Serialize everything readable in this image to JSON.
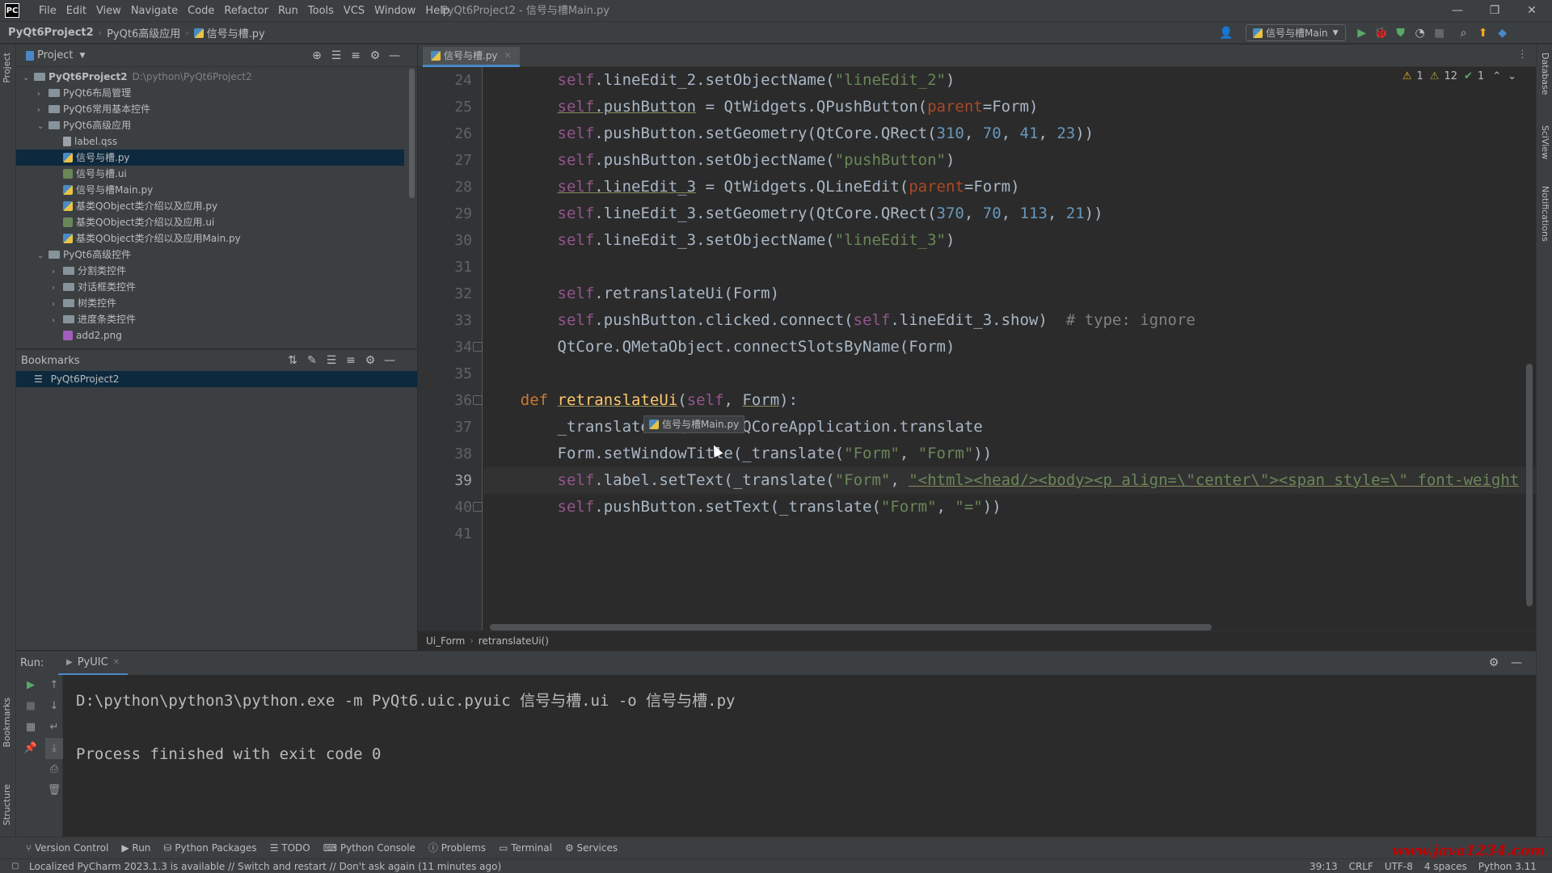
{
  "titlebar": {
    "logo": "PC",
    "menu": [
      "File",
      "Edit",
      "View",
      "Navigate",
      "Code",
      "Refactor",
      "Run",
      "Tools",
      "VCS",
      "Window",
      "Help"
    ],
    "window_title": "PyQt6Project2 - 信号与槽Main.py",
    "minimize": "—",
    "restore": "❐",
    "close": "✕"
  },
  "navbar": {
    "crumbs": [
      "PyQt6Project2",
      "PyQt6高级应用",
      "信号与槽.py"
    ],
    "run_config": "信号与槽Main"
  },
  "stripes": {
    "left_top": "Project",
    "left_bookmarks": "Bookmarks",
    "left_structure": "Structure",
    "right_database": "Database",
    "right_sciview": "SciView",
    "right_notifications": "Notifications"
  },
  "project_panel": {
    "title": "Project",
    "tree": [
      {
        "label": "PyQt6Project2",
        "hint": "D:\\python\\PyQt6Project2",
        "type": "folder",
        "indent": 0,
        "expanded": true,
        "bold": true
      },
      {
        "label": "PyQt6布局管理",
        "type": "folder",
        "indent": 1,
        "expanded": false
      },
      {
        "label": "PyQt6常用基本控件",
        "type": "folder",
        "indent": 1,
        "expanded": false
      },
      {
        "label": "PyQt6高级应用",
        "type": "folder",
        "indent": 1,
        "expanded": true
      },
      {
        "label": "label.qss",
        "type": "qss",
        "indent": 2
      },
      {
        "label": "信号与槽.py",
        "type": "py",
        "indent": 2,
        "selected": true
      },
      {
        "label": "信号与槽.ui",
        "type": "ui",
        "indent": 2
      },
      {
        "label": "信号与槽Main.py",
        "type": "py",
        "indent": 2
      },
      {
        "label": "基类QObject类介绍以及应用.py",
        "type": "py",
        "indent": 2
      },
      {
        "label": "基类QObject类介绍以及应用.ui",
        "type": "ui",
        "indent": 2
      },
      {
        "label": "基类QObject类介绍以及应用Main.py",
        "type": "py",
        "indent": 2
      },
      {
        "label": "PyQt6高级控件",
        "type": "folder",
        "indent": 1,
        "expanded": true
      },
      {
        "label": "分割类控件",
        "type": "folder",
        "indent": 2,
        "expanded": false
      },
      {
        "label": "对话框类控件",
        "type": "folder",
        "indent": 2,
        "expanded": false
      },
      {
        "label": "树类控件",
        "type": "folder",
        "indent": 2,
        "expanded": false
      },
      {
        "label": "进度条类控件",
        "type": "folder",
        "indent": 2,
        "expanded": false
      },
      {
        "label": "add2.png",
        "type": "png",
        "indent": 2
      }
    ]
  },
  "bookmarks_panel": {
    "title": "Bookmarks",
    "items": [
      "PyQt6Project2"
    ]
  },
  "editor": {
    "tab_label": "信号与槽.py",
    "inspection": {
      "warnings": "1",
      "weak_warnings": "12",
      "typos": "1"
    },
    "line_numbers": [
      "24",
      "25",
      "26",
      "27",
      "28",
      "29",
      "30",
      "31",
      "32",
      "33",
      "34",
      "35",
      "36",
      "37",
      "38",
      "39",
      "40",
      "41"
    ],
    "current_line": "39",
    "tooltip": "信号与槽Main.py",
    "breadcrumb": [
      "Ui_Form",
      "retranslateUi()"
    ]
  },
  "run_panel": {
    "label": "Run:",
    "tab": "PyUIC",
    "console": [
      "D:\\python\\python3\\python.exe -m PyQt6.uic.pyuic 信号与槽.ui -o 信号与槽.py",
      "",
      "Process finished with exit code 0"
    ]
  },
  "bottom_tools": [
    "Version Control",
    "Run",
    "Python Packages",
    "TODO",
    "Python Console",
    "Problems",
    "Terminal",
    "Services"
  ],
  "statusbar": {
    "message": "Localized PyCharm 2023.1.3 is available // Switch and restart // Don't ask again (11 minutes ago)",
    "position": "39:13",
    "line_sep": "CRLF",
    "encoding": "UTF-8",
    "indent": "4 spaces",
    "interpreter": "Python 3.11",
    "watermark": "www.java1234.com"
  },
  "colors": {
    "accent": "#4a88c7",
    "keyword": "#cc7832",
    "self": "#94558d",
    "string": "#6a8759",
    "number": "#6897bb",
    "function": "#ffc66d"
  }
}
